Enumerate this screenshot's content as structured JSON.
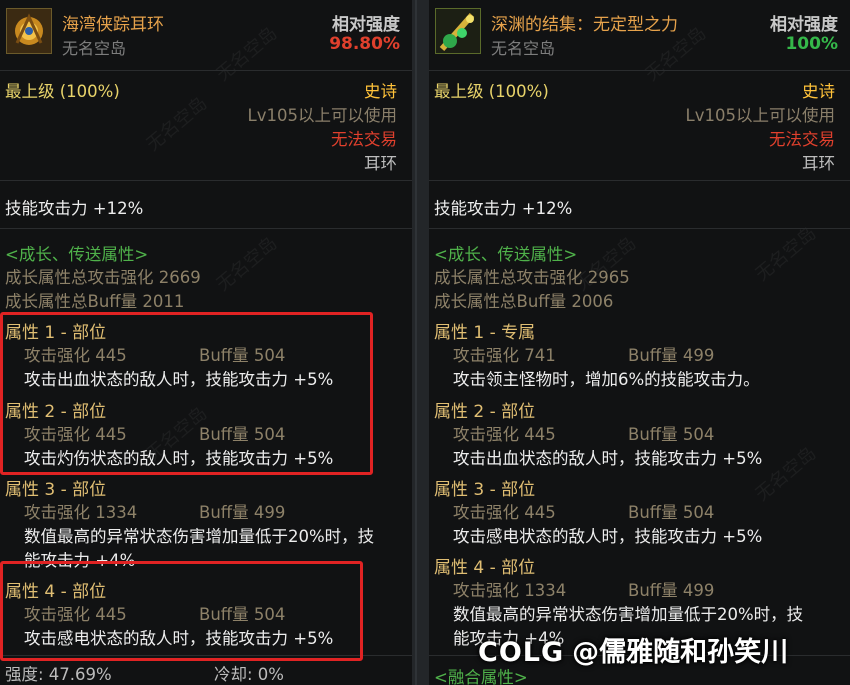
{
  "left": {
    "item_name": "海湾侠踪耳环",
    "author": "无名空岛",
    "rel_label": "相对强度",
    "rel_value": "98.80%",
    "grade": "最上级 (100%)",
    "rarity": "史诗",
    "level_req": "Lv105以上可以使用",
    "trade": "无法交易",
    "slot": "耳环",
    "skill_atk": "技能攻击力  +12%",
    "growth_header": "<成长、传送属性>",
    "growth_atk": "成长属性总攻击强化 2669",
    "growth_buff": "成长属性总Buff量 2011",
    "options": [
      {
        "title": "属性 1 - 部位",
        "atk": "攻击强化  445",
        "buff": "Buff量  504",
        "desc": "攻击出血状态的敌人时，技能攻击力 +5%"
      },
      {
        "title": "属性 2 - 部位",
        "atk": "攻击强化  445",
        "buff": "Buff量  504",
        "desc": "攻击灼伤状态的敌人时，技能攻击力 +5%"
      },
      {
        "title": "属性 3 - 部位",
        "atk": "攻击强化  1334",
        "buff": "Buff量  499",
        "desc": "数值最高的异常状态伤害增加量低于20%时，技",
        "desc2": "能攻击力 +4%"
      },
      {
        "title": "属性 4 - 部位",
        "atk": "攻击强化  445",
        "buff": "Buff量  504",
        "desc": "攻击感电状态的敌人时，技能攻击力 +5%"
      }
    ],
    "footer_strength": "强度: 47.69%",
    "footer_cooldown": "冷却: 0%"
  },
  "right": {
    "item_name": "深渊的结集：无定型之力",
    "author": "无名空岛",
    "rel_label": "相对强度",
    "rel_value": "100%",
    "grade": "最上级 (100%)",
    "rarity": "史诗",
    "level_req": "Lv105以上可以使用",
    "trade": "无法交易",
    "slot": "耳环",
    "skill_atk": "技能攻击力  +12%",
    "growth_header": "<成长、传送属性>",
    "growth_atk": "成长属性总攻击强化 2965",
    "growth_buff": "成长属性总Buff量 2006",
    "options": [
      {
        "title": "属性 1 - 专属",
        "atk": "攻击强化  741",
        "buff": "Buff量  499",
        "desc": "攻击领主怪物时，增加6%的技能攻击力。"
      },
      {
        "title": "属性 2 - 部位",
        "atk": "攻击强化  445",
        "buff": "Buff量  504",
        "desc": "攻击出血状态的敌人时，技能攻击力 +5%"
      },
      {
        "title": "属性 3 - 部位",
        "atk": "攻击强化  445",
        "buff": "Buff量  504",
        "desc": "攻击感电状态的敌人时，技能攻击力 +5%"
      },
      {
        "title": "属性 4 - 部位",
        "atk": "攻击强化  1334",
        "buff": "Buff量  499",
        "desc": "数值最高的异常状态伤害增加量低于20%时，技",
        "desc2": "能攻击力 +4%"
      }
    ],
    "fusion_header": "<融合属性>"
  },
  "overlay": {
    "brand": "COLG",
    "author": "@儒雅随和孙笑川"
  },
  "watermark_text": "无名空岛",
  "colors": {
    "highlight_box": "#e02323",
    "rel_left": "#e0402d",
    "rel_right": "#35b84a",
    "gold_title": "#e6a24b",
    "epic": "#ffc23a"
  }
}
